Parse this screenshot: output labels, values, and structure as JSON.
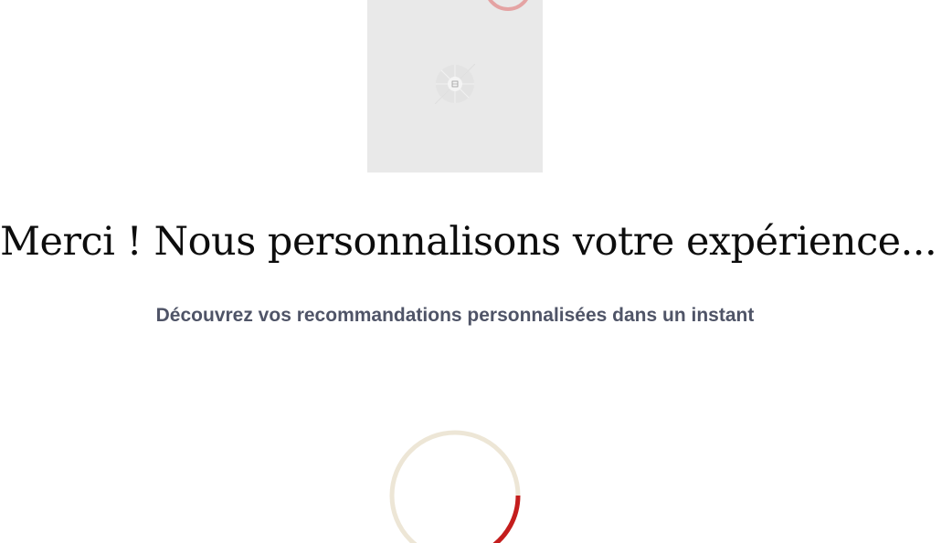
{
  "hero": {
    "image_alt": "",
    "placeholder_icon": "image-icon"
  },
  "heading": "Merci ! Nous personnalisons votre expérience...",
  "subtitle": "Découvrez vos recommandations personnalisées dans un instant",
  "loader": {
    "progress": 0.16,
    "track_color": "#ede6d6",
    "accent_color": "#c41d1d"
  },
  "colors": {
    "heading": "#0d0d0d",
    "subtitle": "#4f5467",
    "placeholder_bg": "#e9e9e9"
  }
}
